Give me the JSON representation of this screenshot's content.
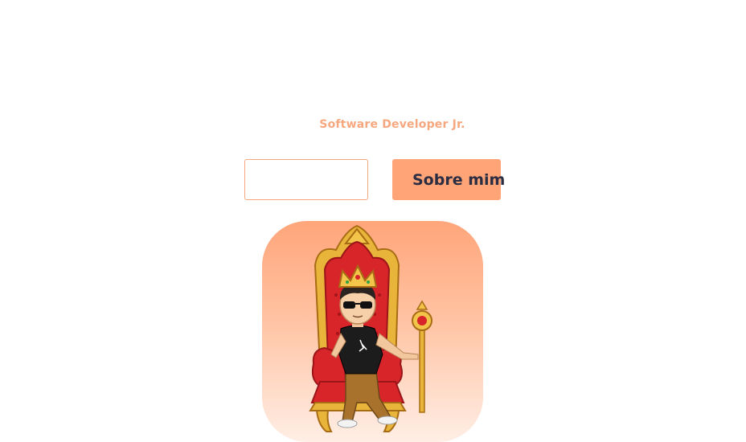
{
  "profile": {
    "role": "Software Developer Jr."
  },
  "actions": {
    "outline_label": "",
    "primary_label": "Sobre mim"
  },
  "theme": {
    "accent": "#ffa477",
    "accent_text": "#f6a77d",
    "text_dark": "#2b2d42"
  },
  "avatar": {
    "icon": "king-on-throne-avatar"
  }
}
